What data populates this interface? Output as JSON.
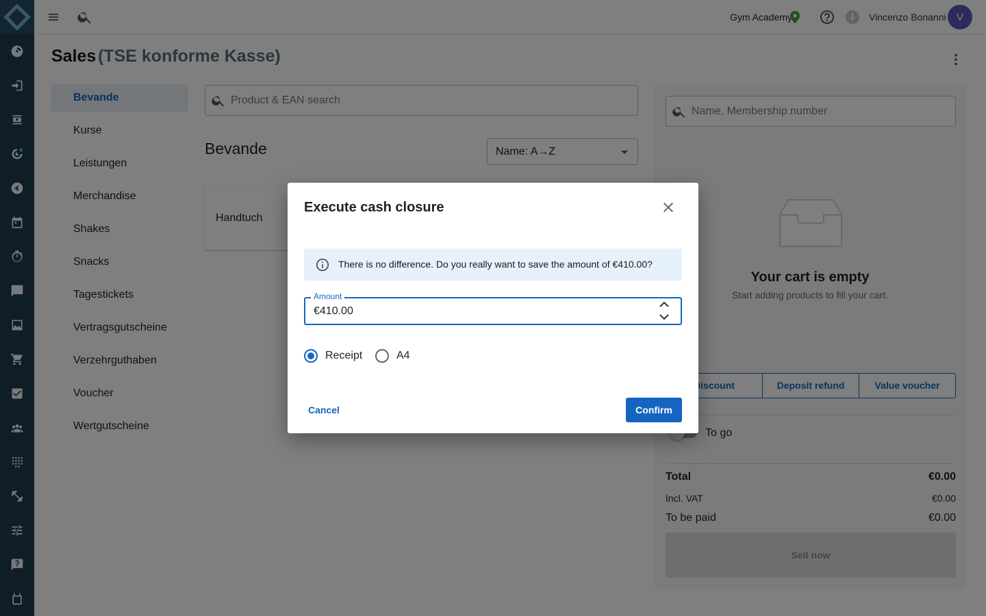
{
  "topbar": {
    "studio_name": "Gym Academy",
    "user_name": "Vincenzo Bonanni",
    "avatar_initial": "V"
  },
  "header": {
    "title": "Sales",
    "subtitle": "(TSE konforme Kasse)"
  },
  "sidebar_nav_icons": [
    "dashboard-icon",
    "check-in-icon",
    "contacts-icon",
    "marketing-icon",
    "finance-icon",
    "calendar-icon",
    "timer-icon",
    "chat-icon",
    "analytics-icon",
    "shop-icon",
    "tasks-icon",
    "members-icon",
    "devices-icon",
    "workout-icon",
    "settings-icon",
    "support-icon",
    "store-icon"
  ],
  "categories": [
    {
      "label": "Bevande",
      "active": true
    },
    {
      "label": "Kurse",
      "active": false
    },
    {
      "label": "Leistungen",
      "active": false
    },
    {
      "label": "Merchandise",
      "active": false
    },
    {
      "label": "Shakes",
      "active": false
    },
    {
      "label": "Snacks",
      "active": false
    },
    {
      "label": "Tagestickets",
      "active": false
    },
    {
      "label": "Vertragsgutscheine",
      "active": false
    },
    {
      "label": "Verzehrguthaben",
      "active": false
    },
    {
      "label": "Voucher",
      "active": false
    },
    {
      "label": "Wertgutscheine",
      "active": false
    }
  ],
  "products": {
    "search_placeholder": "Product & EAN search",
    "section_title": "Bevande",
    "sort_value": "Name: A→Z",
    "items": [
      "Handtuch"
    ]
  },
  "cart": {
    "search_placeholder": "Name, Membership number",
    "empty_title": "Your cart is empty",
    "empty_subtitle": "Start adding products to fill your cart.",
    "buttons": [
      "Discount",
      "Deposit refund",
      "Value voucher"
    ],
    "to_go_label": "To go",
    "total_label": "Total",
    "total_value": "€0.00",
    "vat_label": "Incl. VAT",
    "vat_value": "€0.00",
    "to_be_paid_label": "To be paid",
    "to_be_paid_value": "€0.00",
    "sell_label": "Sell now"
  },
  "dialog": {
    "title": "Execute cash closure",
    "alert_text": "There is no difference. Do you really want to save the amount of €410.00?",
    "amount_label": "Amount",
    "amount_value": "€410.00",
    "radio_receipt": "Receipt",
    "radio_a4": "A4",
    "selected_format": "Receipt",
    "cancel_label": "Cancel",
    "confirm_label": "Confirm"
  },
  "colors": {
    "primary": "#1565c0",
    "rail": "#1e3a4c",
    "alert_bg": "#e7f1fb",
    "avatar": "#5a55b8"
  }
}
